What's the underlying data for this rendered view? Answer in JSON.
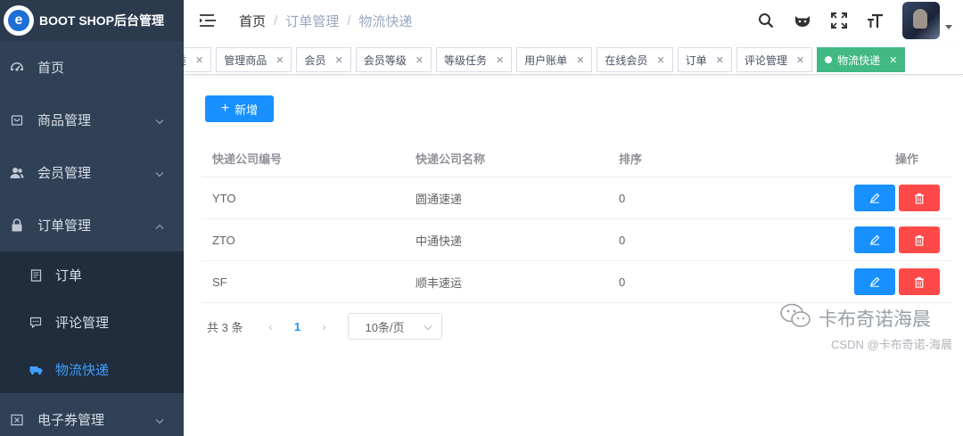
{
  "app": {
    "logo_letter": "e",
    "title": "BOOT SHOP后台管理"
  },
  "sidebar": {
    "items": [
      {
        "label": "首页"
      },
      {
        "label": "商品管理"
      },
      {
        "label": "会员管理"
      },
      {
        "label": "订单管理"
      }
    ],
    "sub_items": [
      {
        "label": "订单"
      },
      {
        "label": "评论管理"
      },
      {
        "label": "物流快递"
      }
    ],
    "bottom_item": {
      "label": "电子券管理"
    }
  },
  "breadcrumb": {
    "home": "首页",
    "parent": "订单管理",
    "current": "物流快递"
  },
  "tags": [
    {
      "label": "分类"
    },
    {
      "label": "管理商品"
    },
    {
      "label": "会员"
    },
    {
      "label": "会员等级"
    },
    {
      "label": "等级任务"
    },
    {
      "label": "用户账单"
    },
    {
      "label": "在线会员"
    },
    {
      "label": "订单"
    },
    {
      "label": "评论管理"
    },
    {
      "label": "物流快递"
    }
  ],
  "toolbar": {
    "add_label": "新增"
  },
  "table": {
    "headers": [
      "快递公司编号",
      "快递公司名称",
      "排序",
      "操作"
    ],
    "rows": [
      {
        "code": "YTO",
        "name": "圆通速递",
        "sort": "0"
      },
      {
        "code": "ZTO",
        "name": "中通快递",
        "sort": "0"
      },
      {
        "code": "SF",
        "name": "顺丰速运",
        "sort": "0"
      }
    ]
  },
  "pagination": {
    "total": "共 3 条",
    "current": "1",
    "page_size": "10条/页"
  },
  "watermark": {
    "line1": "卡布奇诺海晨",
    "line2": "CSDN @卡布奇诺-海晨"
  },
  "colors": {
    "sidebar_bg": "#304156",
    "primary": "#1890ff",
    "danger": "#ff4949",
    "active_tag": "#42b983",
    "active_menu": "#409eff"
  }
}
